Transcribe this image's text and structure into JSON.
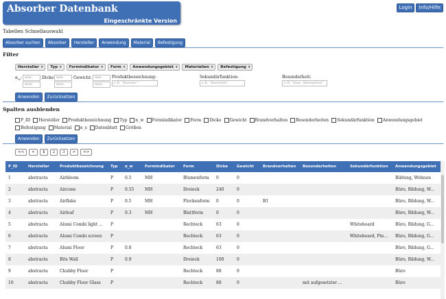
{
  "header": {
    "title": "Absorber Datenbank",
    "subtitle": "Eingeschränkte Version"
  },
  "top_buttons": {
    "login": "Login",
    "info": "Info/Hilfe"
  },
  "quick": {
    "label": "Tabellen Schnellauswahl",
    "buttons": [
      "Absorber suchen",
      "Absorber",
      "Hersteller",
      "Anwendung",
      "Material",
      "Befestigung"
    ]
  },
  "filter": {
    "title": "Filter",
    "dropdowns": [
      "Hersteller",
      "Typ",
      "Formindikator",
      "Form",
      "Anwendungsgebiet",
      "Materialien",
      "Befestigung"
    ],
    "alpha_label": "α",
    "alpha_sub": "w",
    "dicke_label": "Dicke:",
    "gewicht_label": "Gewicht:",
    "min": "min.",
    "max": "max.",
    "produkt_label": "Produktbezeichnung:",
    "produkt_ph": "z.B. \"Rosotec\"",
    "sek_label": "Sekundärfunktion:",
    "sek_ph": "z.B. \"Bassfalle\"",
    "bes_label": "Besonderheit:",
    "bes_ph": "z.B. \"max. Absorption\"",
    "apply": "Anwenden",
    "reset": "Zurücksetzen"
  },
  "hide": {
    "title": "Spalten ausblenden",
    "items": [
      "P_ID",
      "Hersteller",
      "Produktbezeichnung",
      "Typ",
      "α_w",
      "Formindikator",
      "Form",
      "Dicke",
      "Gewicht",
      "Brandverhalten",
      "Besonderheiten",
      "Sekundärfunktion",
      "Anwendungsgebiet",
      "Befestigung",
      "Material",
      "α_s",
      "Datenblatt",
      "Größen"
    ],
    "apply": "Anwenden",
    "reset": "Zurücksetzen"
  },
  "pager": {
    "first": "<<",
    "prev": "<",
    "pages": [
      "1",
      "2",
      "3"
    ],
    "next": ">",
    "last": ">>",
    "current": "1"
  },
  "table": {
    "columns": [
      "P_ID",
      "Hersteller",
      "Produktbezeichnung",
      "Typ",
      "α_w",
      "Formindikator",
      "Form",
      "Dicke",
      "Gewicht",
      "Brandverhalten",
      "Besonderheiten",
      "Sekundärfunktion",
      "Anwendungsgebiet"
    ],
    "rows": [
      [
        "1",
        "abstracta",
        "Airbloom",
        "P",
        "0.5",
        "MH",
        "Blumenform",
        "0",
        "0",
        "",
        "",
        "",
        "Bildung, Wohnen"
      ],
      [
        "2",
        "abstracta",
        "Aircone",
        "P",
        "0.55",
        "MH",
        "Dreieck",
        "240",
        "0",
        "",
        "",
        "",
        "Büro, Bildung, W..."
      ],
      [
        "3",
        "abstracta",
        "Airflake",
        "P",
        "0.5",
        "MH",
        "Flockenform",
        "0",
        "0",
        "B1",
        "",
        "",
        "Büro, Bildung, W..."
      ],
      [
        "4",
        "abstracta",
        "Airleaf",
        "P",
        "0.3",
        "MH",
        "Blattform",
        "0",
        "0",
        "",
        "",
        "",
        "Büro, Bildung, W..."
      ],
      [
        "5",
        "abstracta",
        "Alumi Combi light ...",
        "P",
        "",
        "",
        "Rechteck",
        "63",
        "0",
        "",
        "",
        "Whiteboard",
        "Büro, Bildung, G..."
      ],
      [
        "6",
        "abstracta",
        "Alumi Combi screen",
        "P",
        "",
        "",
        "Rechteck",
        "63",
        "0",
        "",
        "",
        "Whiteboard, Pinn...",
        "Büro, Bildung, G..."
      ],
      [
        "7",
        "abstracta",
        "Alumi Floor",
        "P",
        "0.8",
        "",
        "Rechteck",
        "63",
        "0",
        "",
        "",
        "",
        "Büro, Bildung, G..."
      ],
      [
        "8",
        "abstracta",
        "Bits Wall",
        "P",
        "0.9",
        "",
        "Dreieck",
        "100",
        "0",
        "",
        "",
        "",
        "Büro, Bildung, W..."
      ],
      [
        "9",
        "abstracta",
        "Chubby Floor",
        "P",
        "",
        "",
        "Rechteck",
        "88",
        "0",
        "",
        "",
        "",
        "Büro"
      ],
      [
        "10",
        "abstracta",
        "Chubby Floor Glass",
        "P",
        "",
        "",
        "Rechteck",
        "88",
        "0",
        "",
        "mit aufgesetzter ...",
        "",
        "Büro"
      ]
    ]
  }
}
